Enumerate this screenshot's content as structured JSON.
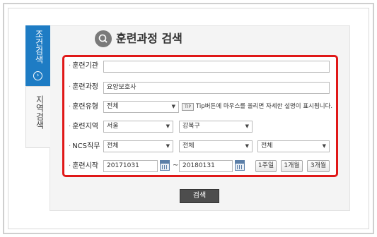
{
  "side_tabs": {
    "active": {
      "label": "조건검색",
      "arrow": "›"
    },
    "inactive": {
      "label": "지역검색"
    }
  },
  "header": {
    "title": "훈련과정 검색",
    "icon": "search-icon"
  },
  "form": {
    "institution": {
      "label": "훈련기관",
      "value": ""
    },
    "course": {
      "label": "훈련과정",
      "value": "요양보호사"
    },
    "type": {
      "label": "훈련유형",
      "selected": "전체",
      "tip_badge": "TIP",
      "tip_text": "Tip버튼에 마우스를 올리면 자세한 설명이 표시됩니다."
    },
    "region": {
      "label": "훈련지역",
      "selected": "서울",
      "sub_selected": "강북구"
    },
    "ncs": {
      "label": "NCS직무",
      "selected1": "전체",
      "selected2": "전체",
      "selected3": "전체"
    },
    "start": {
      "label": "훈련시작",
      "from": "20171031",
      "separator": "~",
      "to": "20180131",
      "btn_1w": "1주일",
      "btn_1m": "1개월",
      "btn_3m": "3개월"
    }
  },
  "actions": {
    "search_label": "검색"
  },
  "colors": {
    "accent_blue": "#1e7cc4",
    "highlight_red": "#e01818",
    "button_dark": "#4d4d4d"
  }
}
